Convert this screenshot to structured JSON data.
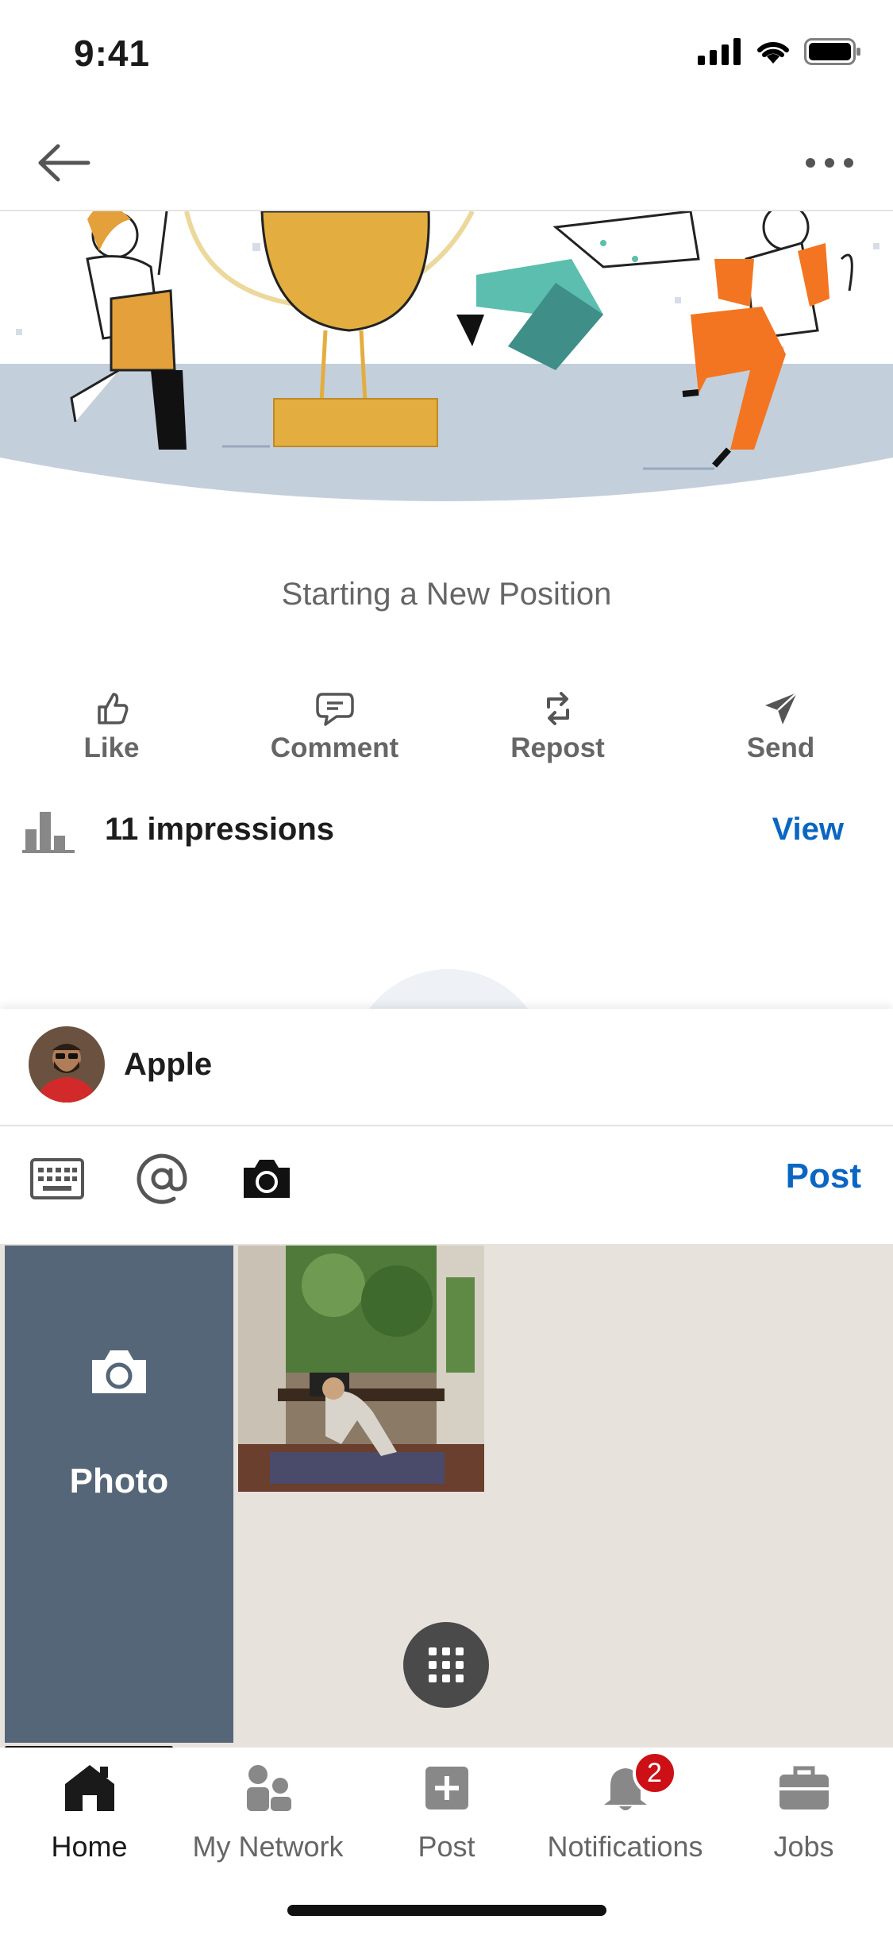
{
  "status_bar": {
    "time": "9:41"
  },
  "post": {
    "title": "Starting a New Position",
    "actions": [
      {
        "label": "Like",
        "icon": "thumbs-up-icon"
      },
      {
        "label": "Comment",
        "icon": "comment-icon"
      },
      {
        "label": "Repost",
        "icon": "repost-icon"
      },
      {
        "label": "Send",
        "icon": "send-icon"
      }
    ],
    "impressions_text": "11 impressions",
    "view_label": "View"
  },
  "composer": {
    "author_name": "Apple",
    "post_label": "Post"
  },
  "gallery": {
    "photo_label": "Photo"
  },
  "tab_bar": {
    "tabs": [
      {
        "label": "Home",
        "icon": "home-icon",
        "active": true
      },
      {
        "label": "My Network",
        "icon": "my-network-icon"
      },
      {
        "label": "Post",
        "icon": "add-post-icon"
      },
      {
        "label": "Notifications",
        "icon": "bell-icon",
        "badge": "2"
      },
      {
        "label": "Jobs",
        "icon": "briefcase-icon"
      }
    ]
  },
  "colors": {
    "link_blue": "#0a66c2",
    "badge_red": "#cc1016",
    "photo_tile": "#566679",
    "gallery_bg": "#e7e2dc"
  }
}
